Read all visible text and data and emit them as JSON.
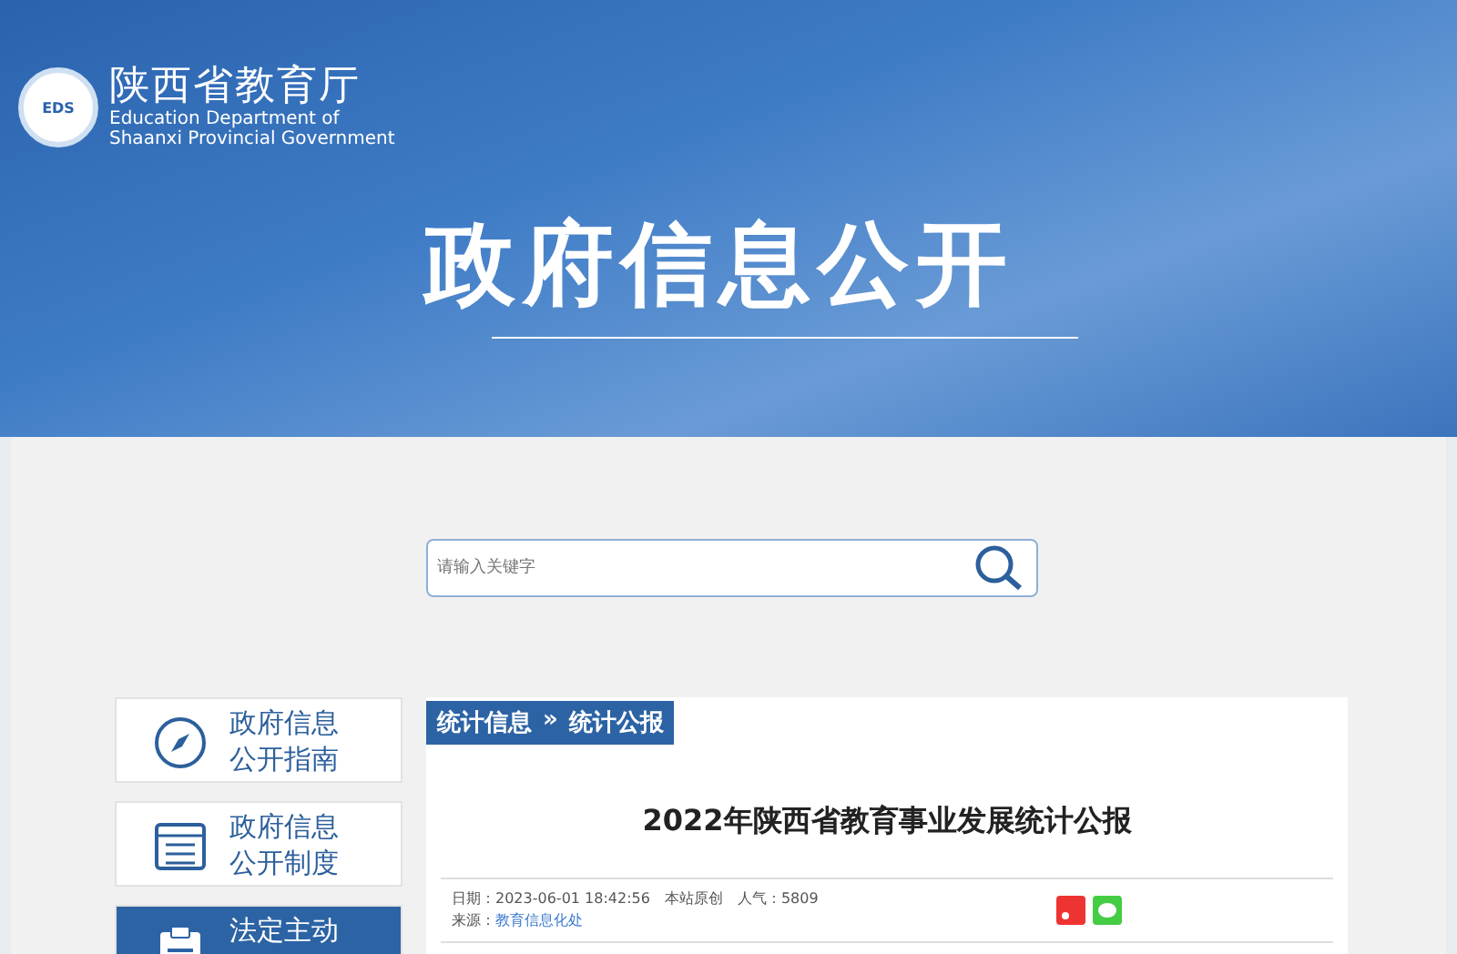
{
  "header": {
    "org_name": "陕西省教育厅",
    "org_name_en_1": "Education Department of",
    "org_name_en_2": "Shaanxi Provincial Government",
    "logo_text": "EDS",
    "banner_title": "政府信息公开"
  },
  "search": {
    "placeholder": "请输入关键字"
  },
  "sidebar": {
    "items": [
      {
        "line1": "政府信息",
        "line2": "公开指南",
        "kind": "compass",
        "selected": false
      },
      {
        "line1": "政府信息",
        "line2": "公开制度",
        "kind": "list",
        "selected": false
      },
      {
        "line1": "法定主动",
        "kind": "clipboard",
        "selected": true
      }
    ]
  },
  "article": {
    "breadcrumb": [
      "统计信息",
      "统计公报"
    ],
    "breadcrumb_sep": "»",
    "title": "2022年陕西省教育事业发展统计公报",
    "meta_line": "日期：2023-06-01 18:42:56　本站原创　人气：5809",
    "source_label": "来源：",
    "source_link": "教育信息化处"
  }
}
